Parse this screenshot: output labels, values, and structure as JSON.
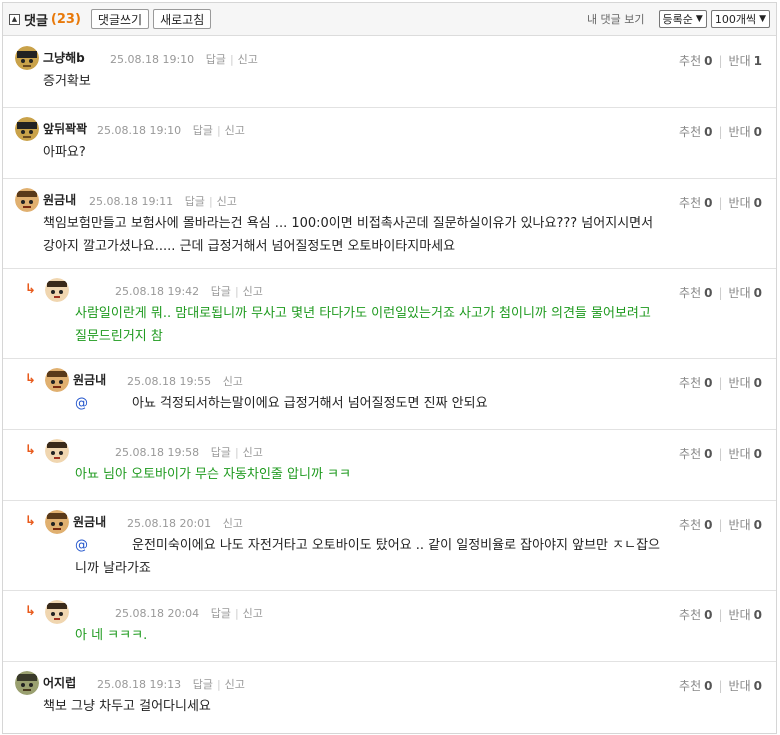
{
  "header": {
    "title": "댓글",
    "count": "(23)",
    "write_button": "댓글쓰기",
    "refresh_button": "새로고침",
    "my_comments": "내 댓글 보기",
    "sort_selected": "등록순",
    "per_page_selected": "100개씩"
  },
  "vote_labels": {
    "up": "추천",
    "down": "반대"
  },
  "action_labels": {
    "reply": "답글",
    "report": "신고"
  },
  "comments": [
    {
      "nick": "그냥해b",
      "time": "25.08.18 19:10",
      "up": "0",
      "down": "1",
      "line1": "증거확보",
      "line2": ""
    },
    {
      "nick": "앞뒤꽉꽉",
      "time": "25.08.18 19:10",
      "up": "0",
      "down": "0",
      "line1": "아파요?",
      "line2": ""
    },
    {
      "nick": "원금내",
      "time": "25.08.18 19:11",
      "up": "0",
      "down": "0",
      "line1": "책임보험만들고 보험사에 몰바라는건 욕심 ... 100:0이면 비접촉사곤데 질문하실이유가 있나요??? 넘어지시면서",
      "line2": "강아지 깔고가셨나요..... 근데 급정거해서 넘어질정도면 오토바이타지마세요"
    },
    {
      "nick": "",
      "time": "25.08.18 19:42",
      "up": "0",
      "down": "0",
      "line1": "사람일이란게 뭐.. 맘대로됩니까 무사고 몇년 타다가도 이런일있는거죠 사고가 첨이니까 의견들 물어보려고",
      "line2": "질문드린거지 참"
    },
    {
      "nick": "원금내",
      "time": "25.08.18 19:55",
      "up": "0",
      "down": "0",
      "mention": "@",
      "line1": "아뇨 걱정되서하는말이에요 급정거해서 넘어질정도면 진짜 안되요",
      "line2": ""
    },
    {
      "nick": "",
      "time": "25.08.18 19:58",
      "up": "0",
      "down": "0",
      "line1": "아뇨 님아 오토바이가 무슨 자동차인줄 압니까 ㅋㅋ",
      "line2": ""
    },
    {
      "nick": "원금내",
      "time": "25.08.18 20:01",
      "up": "0",
      "down": "0",
      "mention": "@",
      "line1": "운전미숙이에요 나도 자전거타고 오토바이도 탔어요 .. 같이 일정비율로 잡아야지 앞브만 ㅈㄴ잡으",
      "line2": "니까 날라가죠"
    },
    {
      "nick": "",
      "time": "25.08.18 20:04",
      "up": "0",
      "down": "0",
      "line1": "아 네 ㅋㅋㅋ.",
      "line2": ""
    },
    {
      "nick": "어지럽",
      "time": "25.08.18 19:13",
      "up": "0",
      "down": "0",
      "line1": "책보 그냥 차두고 걸어다니세요",
      "line2": ""
    }
  ]
}
